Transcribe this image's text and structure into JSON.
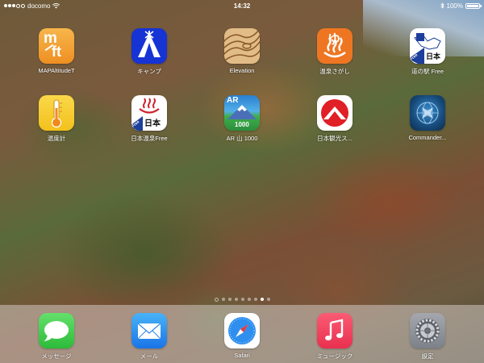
{
  "status_bar": {
    "carrier": "docomo",
    "time": "14:32",
    "battery_label": "100%",
    "battery_level": 1.0,
    "icons": [
      "signal-dots-icon",
      "wifi-icon",
      "bluetooth-icon",
      "battery-icon"
    ]
  },
  "apps": [
    {
      "label": "MAPAltitudeT",
      "icon": "mft-icon",
      "color": "#f0a03a"
    },
    {
      "label": "キャンプ",
      "icon": "tent-icon",
      "color": "#1a3bd6"
    },
    {
      "label": "Elevation",
      "icon": "wood-grain-icon",
      "color": "#d9b07a"
    },
    {
      "label": "温泉さがし",
      "icon": "onsen-yu-icon",
      "color": "#ef7a22"
    },
    {
      "label": "道の駅 Free",
      "icon": "michinoeki-icon",
      "color": "#ffffff"
    },
    {
      "label": "温度計",
      "icon": "thermometer-icon",
      "color": "#f5cc1f"
    },
    {
      "label": "日本温泉Free",
      "icon": "onsen-japan-icon",
      "color": "#ffffff"
    },
    {
      "label": "AR 山 1000",
      "icon": "ar-mountain-icon",
      "color": "#2a8fd8"
    },
    {
      "label": "日本観光ス...",
      "icon": "fuji-red-icon",
      "color": "#e01f26"
    },
    {
      "label": "Commander...",
      "icon": "commander-globe-icon",
      "color": "#1b5c8f"
    }
  ],
  "icon_text": {
    "mft": [
      "m",
      "ft"
    ],
    "ar": "AR",
    "ar_sub": "1000",
    "onsen_kanji": "日本",
    "free": "Free",
    "eki_kanji": "日本",
    "yu": "ゆ"
  },
  "page_indicator": {
    "pages": 8,
    "current": 7
  },
  "dock": [
    {
      "label": "メッセージ",
      "icon": "messages-icon",
      "color": "#3fcf4d"
    },
    {
      "label": "メール",
      "icon": "mail-icon",
      "color": "#2e8ff0"
    },
    {
      "label": "Safari",
      "icon": "safari-compass-icon",
      "color": "#ffffff"
    },
    {
      "label": "ミュージック",
      "icon": "music-note-icon",
      "color": "#f5405f"
    },
    {
      "label": "設定",
      "icon": "settings-gear-icon",
      "color": "#8e9199"
    }
  ]
}
